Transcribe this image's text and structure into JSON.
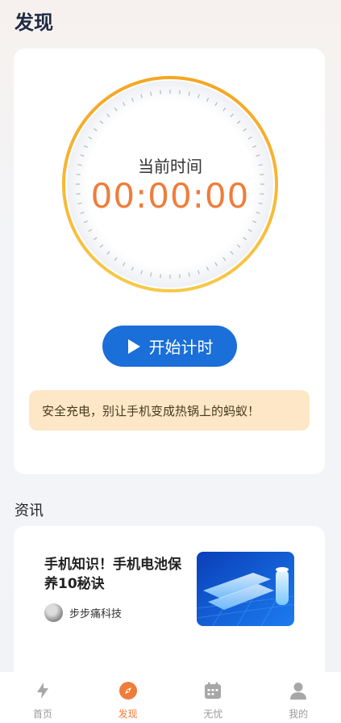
{
  "header": {
    "title": "发现"
  },
  "timer": {
    "label": "当前时间",
    "time": "00:00:00",
    "start_label": "开始计时"
  },
  "tip": {
    "text": "安全充电，别让手机变成热锅上的蚂蚁！"
  },
  "news": {
    "section_title": "资讯",
    "items": [
      {
        "title": "手机知识！手机电池保养10秘诀",
        "source": "步步痛科技"
      }
    ]
  },
  "nav": {
    "items": [
      {
        "label": "首页",
        "icon": "lightning-icon"
      },
      {
        "label": "发现",
        "icon": "compass-icon",
        "active": true
      },
      {
        "label": "无忧",
        "icon": "calendar-icon"
      },
      {
        "label": "我的",
        "icon": "user-icon"
      }
    ]
  },
  "colors": {
    "accent": "#ef7d3a",
    "primary_button": "#1a6fd8",
    "tip_background": "#fde7c6",
    "ring_gradient_start": "#f5a623",
    "ring_gradient_end": "#f6c94a"
  }
}
